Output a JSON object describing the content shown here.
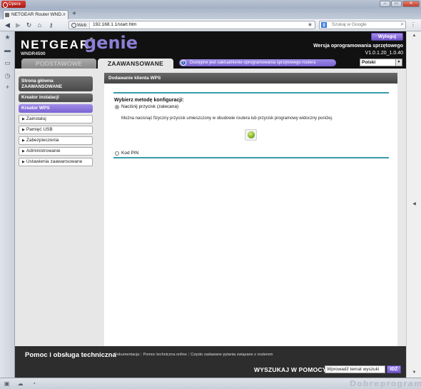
{
  "browser": {
    "app_button": "Opera",
    "window_controls": {
      "minimize": "–",
      "maximize": "▭",
      "close": "✕"
    },
    "tab": {
      "title": "NETGEAR Router WND...",
      "close": "×"
    },
    "new_tab": "+",
    "address": {
      "badge": "Web",
      "url": "192.168.1.1/start.htm"
    },
    "search": {
      "engine_glyph": "g",
      "placeholder": "Szukaj w Google"
    },
    "icons": [
      "back-icon",
      "forward-icon",
      "reload-icon",
      "home-icon",
      "key-icon",
      "star-icon",
      "search-icon",
      "menu-icon"
    ]
  },
  "side_panel_icons": [
    "star-icon",
    "speech-icon",
    "clip-icon",
    "clock-icon",
    "plus-icon"
  ],
  "router": {
    "brand": "NETGEAR",
    "reg_mark": "®",
    "product": "genie",
    "model": "WNDR4500",
    "logout": "Wyloguj",
    "firmware_label": "Wersja oprogramowania sprzętowego",
    "firmware_version": "V1.0.1.20_1.0.40",
    "tabs": {
      "basic": "PODSTAWOWE",
      "advanced": "ZAAWANSOWANE"
    },
    "update_banner": "Dostępne jest uaktualnienie oprogramowania sprzętowego routera",
    "info_glyph": "i",
    "language": "Polski",
    "nav": {
      "home": "Strona główna ZAAWANSOWANE",
      "setup_wizard": "Kreator instalacji",
      "wps_wizard": "Kreator WPS",
      "sub_items": [
        "Zainstaluj",
        "Pamięć USB",
        "Zabezpieczenia",
        "Administrowanie",
        "Ustawienia zaawansowane"
      ]
    },
    "panel": {
      "title": "Dodawanie klienta WPS",
      "method_label": "Wybierz metodę konfiguracji:",
      "option_button": "Naciśnij przycisk (zalecana)",
      "description": "Można nacisnąć fizyczny przycisk umieszczony w obudowie routera lub przycisk programowy widoczny poniżej.",
      "option_pin": "Kod PIN"
    },
    "footer": {
      "title": "Pomoc i obsługa techniczna",
      "links": [
        "Dokumentacja",
        "Pomoc techniczna online",
        "Często zadawane pytania związane z routerem"
      ],
      "link_separator": "|",
      "search_label": "WYSZUKAJ W POMOCY",
      "search_value": "Wprowadź temat wyszuki",
      "go": "IDŹ"
    }
  },
  "status_icons": [
    "panel-icon",
    "cloud-icon",
    "speed-icon"
  ],
  "watermark": "Dobreprogramy",
  "colors": {
    "accent": "#7a63d4",
    "teal": "#3a9aa8",
    "header": "#111111"
  }
}
